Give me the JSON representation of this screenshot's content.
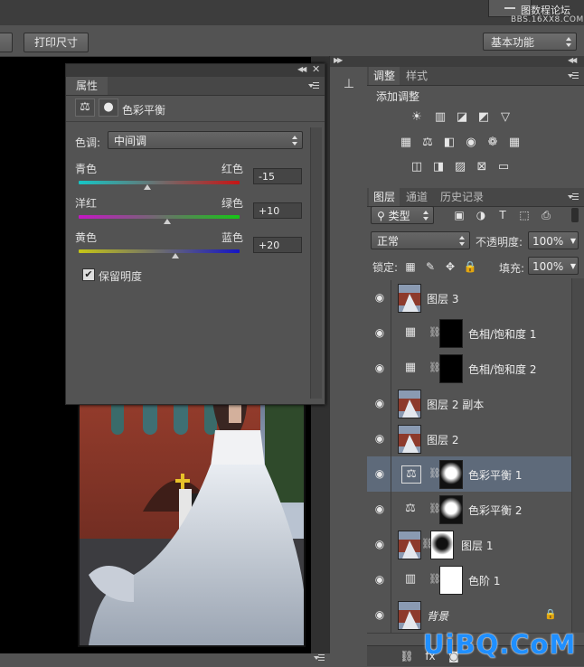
{
  "watermark": {
    "site": "图数程论坛",
    "url": "BBS.16XX8.COM"
  },
  "options_bar": {
    "print_size": "打印尺寸",
    "workspace": "基本功能"
  },
  "properties": {
    "tab": "属性",
    "adjustment_name": "色彩平衡",
    "tone_label": "色调:",
    "tone_value": "中间调",
    "sliders": [
      {
        "left": "青色",
        "right": "红色",
        "value": "-15",
        "level": -15
      },
      {
        "left": "洋红",
        "right": "绿色",
        "value": "+10",
        "level": 10
      },
      {
        "left": "黄色",
        "right": "蓝色",
        "value": "+20",
        "level": 20
      }
    ],
    "preserve_luminosity": "保留明度",
    "preserve_checked": true
  },
  "adjustments": {
    "tabs": [
      "调整",
      "样式"
    ],
    "title": "添加调整",
    "icons_row1": [
      "brightness-icon",
      "levels-icon",
      "curves-icon",
      "exposure-icon",
      "vibrance-icon"
    ],
    "icons_row2": [
      "hue-saturation-icon",
      "color-balance-icon",
      "black-white-icon",
      "photo-filter-icon",
      "channel-mixer-icon",
      "color-lookup-icon"
    ],
    "icons_row3": [
      "invert-icon",
      "posterize-icon",
      "threshold-icon",
      "selective-color-icon",
      "gradient-map-icon"
    ]
  },
  "layers": {
    "tabs": [
      "图层",
      "通道",
      "历史记录"
    ],
    "filter_type": "类型",
    "blend_mode": "正常",
    "opacity_label": "不透明度:",
    "opacity_value": "100%",
    "lock_label": "锁定:",
    "fill_label": "填充:",
    "fill_value": "100%",
    "items": [
      {
        "name": "图层 3",
        "kind": "image"
      },
      {
        "name": "色相/饱和度 1",
        "kind": "hue"
      },
      {
        "name": "色相/饱和度 2",
        "kind": "hue"
      },
      {
        "name": "图层 2 副本",
        "kind": "image"
      },
      {
        "name": "图层 2",
        "kind": "image"
      },
      {
        "name": "色彩平衡 1",
        "kind": "balance",
        "selected": true
      },
      {
        "name": "色彩平衡 2",
        "kind": "balance"
      },
      {
        "name": "图层 1",
        "kind": "image-mask"
      },
      {
        "name": "色阶 1",
        "kind": "levels"
      },
      {
        "name": "背景",
        "kind": "background"
      }
    ]
  },
  "logo": "UiBQ.CoM"
}
